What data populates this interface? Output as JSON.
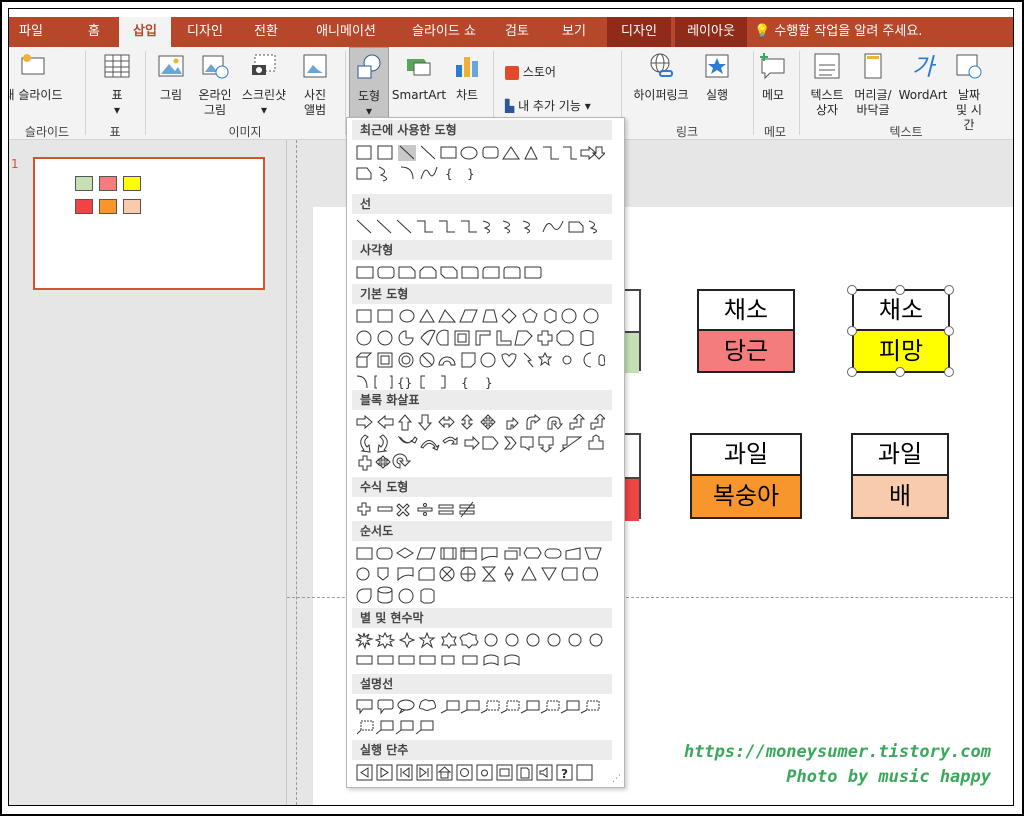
{
  "tabs": [
    {
      "label": "파일",
      "active": false,
      "context": false
    },
    {
      "label": "홈",
      "active": false,
      "context": false
    },
    {
      "label": "삽입",
      "active": true,
      "context": false
    },
    {
      "label": "디자인",
      "active": false,
      "context": false
    },
    {
      "label": "전환",
      "active": false,
      "context": false
    },
    {
      "label": "애니메이션",
      "active": false,
      "context": false
    },
    {
      "label": "슬라이드 쇼",
      "active": false,
      "context": false
    },
    {
      "label": "검토",
      "active": false,
      "context": false
    },
    {
      "label": "보기",
      "active": false,
      "context": false
    },
    {
      "label": "디자인",
      "active": false,
      "context": true
    },
    {
      "label": "레이아웃",
      "active": false,
      "context": true
    }
  ],
  "tell_me": "수행할 작업을 알려 주세요.",
  "ribbon": {
    "new_slide": "새 슬라이드",
    "table": "표",
    "picture": "그림",
    "online_picture": "온라인 그림",
    "screenshot": "스크린샷",
    "photo_album": "사진 앨범",
    "shapes": "도형",
    "smartart": "SmartArt",
    "chart": "차트",
    "store": "스토어",
    "my_addins": "내 추가 기능",
    "hyperlink": "하이퍼링크",
    "action": "실행",
    "comment": "메모",
    "textbox": "텍스트 상자",
    "header_footer": "머리글/ 바닥글",
    "wordart": "WordArt",
    "date_time": "날짜 및 시간",
    "groups": {
      "slides": "슬라이드",
      "tables": "표",
      "images": "이미지",
      "links": "링크",
      "comments": "메모",
      "text": "텍스트"
    }
  },
  "slide_number": "1",
  "cards": [
    {
      "top": "채소",
      "bottom": "당근",
      "color": "#f47c7c"
    },
    {
      "top": "채소",
      "bottom": "피망",
      "color": "#ffff00"
    },
    {
      "top": "과일",
      "bottom": "복숭아",
      "color": "#f7962d"
    },
    {
      "top": "과일",
      "bottom": "배",
      "color": "#f8cbad"
    }
  ],
  "partial_card_colors": [
    "#c5e0b4",
    "#ee4444"
  ],
  "gallery": {
    "sections": [
      "최근에 사용한 도형",
      "선",
      "사각형",
      "기본 도형",
      "블록 화살표",
      "수식 도형",
      "순서도",
      "별 및 현수막",
      "설명선",
      "실행 단추"
    ]
  },
  "watermark": {
    "line1": "https://moneysumer.tistory.com",
    "line2": "Photo by music happy"
  }
}
